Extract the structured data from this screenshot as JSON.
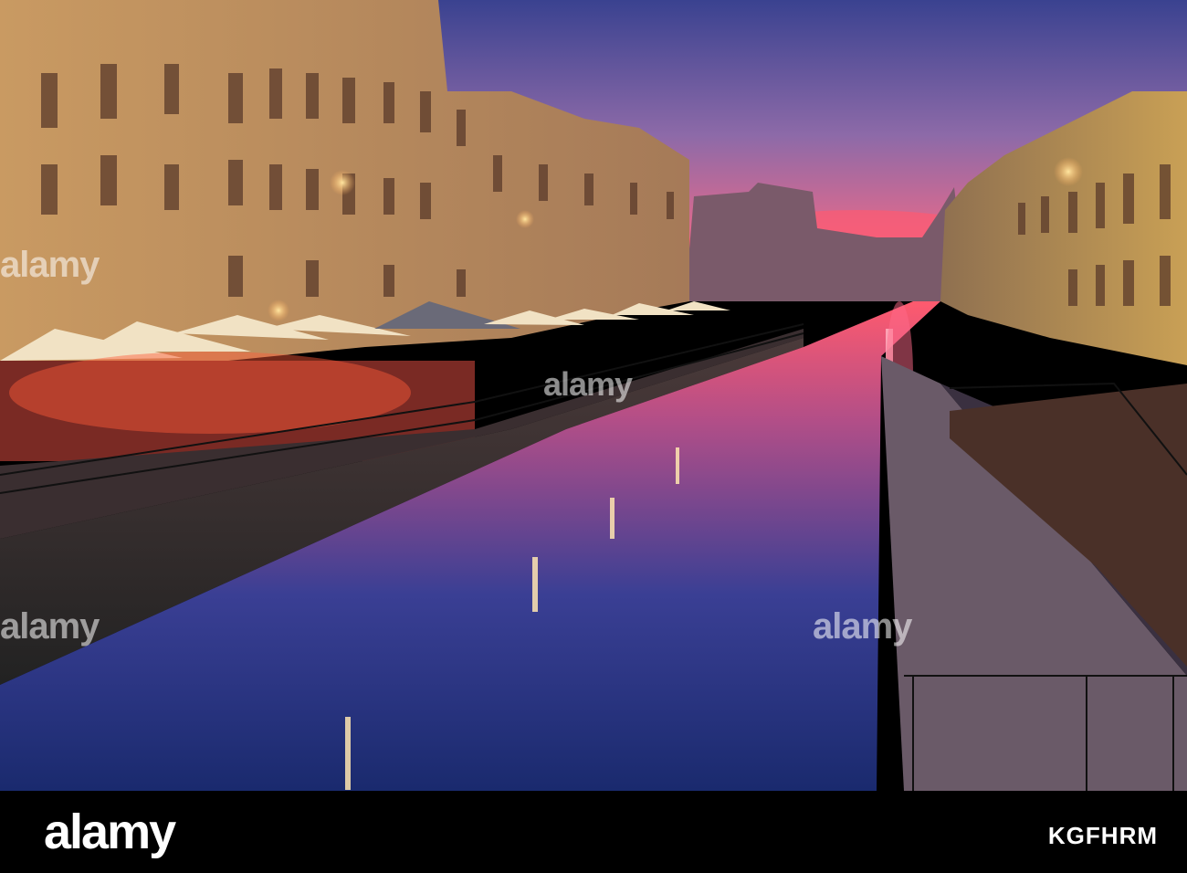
{
  "scene": {
    "description_colors": {
      "sky_top": "#3b3f8f",
      "sky_mid": "#c35a8a",
      "horizon": "#f5476a",
      "water_top": "#e14a6a",
      "water_bottom": "#1c2a6a",
      "facade": "#d6a25a",
      "lamp": "#ffd88a"
    }
  },
  "watermarks": {
    "text": "alamy"
  },
  "footer": {
    "logo": "alamy",
    "stock_label": "",
    "image_code": "KGFHRM"
  }
}
